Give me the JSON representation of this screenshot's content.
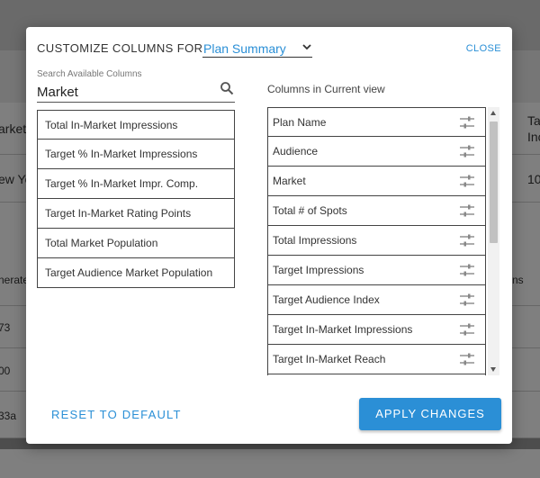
{
  "background": {
    "row1": {
      "left_cell": "arket",
      "right_cell_line1": "Ta",
      "right_cell_line2": "Inc"
    },
    "row2": {
      "left_cell": "ew Yo",
      "right_cell": "10"
    },
    "header2": {
      "left_cell": "nerate",
      "right_cell": "ns"
    },
    "row3": {
      "left_cell": "73"
    },
    "row4": {
      "left_cell": "00"
    },
    "row5": {
      "left_cell": "33a"
    }
  },
  "modal": {
    "title": "CUSTOMIZE COLUMNS FOR",
    "plan_select": {
      "value": "Plan Summary"
    },
    "close_label": "CLOSE",
    "search": {
      "label": "Search Available Columns",
      "value": "Market"
    },
    "available_columns": [
      "Total In-Market Impressions",
      "Target % In-Market Impressions",
      "Target % In-Market Impr. Comp.",
      "Target In-Market Rating Points",
      "Total Market Population",
      "Target Audience Market Population"
    ],
    "current_view": {
      "title": "Columns in Current view",
      "columns": [
        "Plan Name",
        "Audience",
        "Market",
        "Total # of Spots",
        "Total Impressions",
        "Target Impressions",
        "Target Audience Index",
        "Target In-Market Impressions",
        "Target In-Market Reach",
        ""
      ]
    },
    "reset_label": "RESET TO DEFAULT",
    "apply_label": "APPLY CHANGES"
  },
  "colors": {
    "accent": "#2a8fd6",
    "apply_button": "#2b8fd6",
    "overlay": "rgba(0,0,0,0.5)"
  },
  "icons": {
    "plan_select": "chevron-down-icon",
    "search": "search-icon",
    "reorder": "drag-handle-icon",
    "scroll_up": "arrow-up-icon",
    "scroll_down": "arrow-down-icon"
  }
}
